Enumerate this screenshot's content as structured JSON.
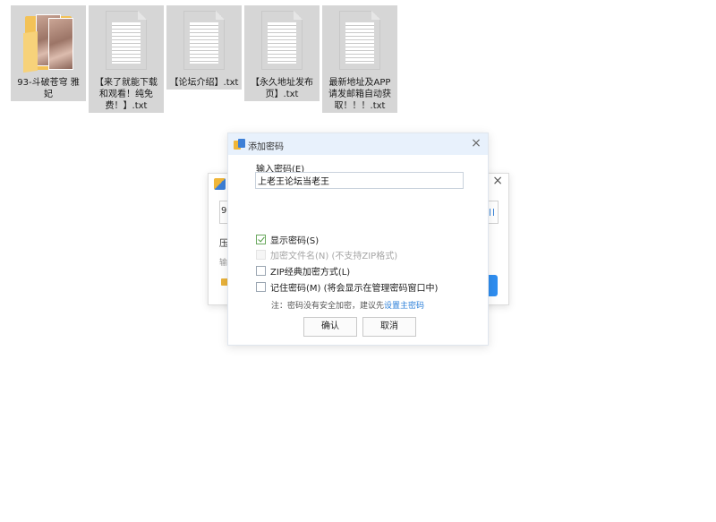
{
  "desktop": {
    "files": [
      {
        "name": "93-斗破苍穹 雅妃",
        "type": "folder"
      },
      {
        "name": "【来了就能下载和观看！纯免费！】.txt",
        "type": "text"
      },
      {
        "name": "【论坛介绍】.txt",
        "type": "text"
      },
      {
        "name": "【永久地址发布页】.txt",
        "type": "text"
      },
      {
        "name": "最新地址及APP请发邮箱自动获取！！！.txt",
        "type": "text"
      }
    ]
  },
  "background_dialog": {
    "field_text": "9",
    "label_1": "压",
    "label_2": "输"
  },
  "dialog": {
    "title": "添加密码",
    "close_icon": "close-icon",
    "password_label": "输入密码(E)",
    "password_value": "上老王论坛当老王",
    "options": {
      "show_password": {
        "label": "显示密码(S)",
        "checked": true,
        "enabled": true
      },
      "encrypt_filenames": {
        "label": "加密文件名(N) (不支持ZIP格式)",
        "checked": false,
        "enabled": false
      },
      "zip_classic": {
        "label": "ZIP经典加密方式(L)",
        "checked": false,
        "enabled": true
      },
      "remember_password": {
        "label": "记住密码(M) (将会显示在管理密码窗口中)",
        "checked": false,
        "enabled": true
      }
    },
    "note_prefix": "注：密码没有安全加密，建议先",
    "note_link": "设置主密码",
    "ok_label": "确认",
    "cancel_label": "取消",
    "colors": {
      "titlebar": "#e8f1fc",
      "link": "#2b7fd9",
      "check": "#4b9a3c"
    }
  }
}
